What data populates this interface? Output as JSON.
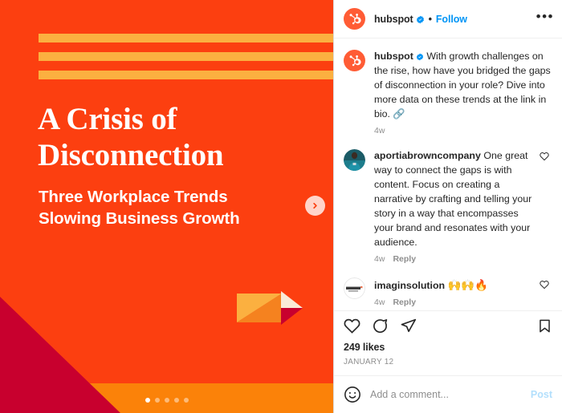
{
  "post": {
    "media": {
      "stripes_count": 3,
      "headline_line1": "A Crisis of",
      "headline_line2": "Disconnection",
      "subhead_line1": "Three Workplace Trends",
      "subhead_line2": "Slowing Business Growth",
      "colors": {
        "background": "#FC3F10",
        "stripe": "#FBB040",
        "band": "#FB8209",
        "wedge": "#C8002E",
        "arrow_light": "#FAEBD7",
        "arrow_mid": "#F5821F"
      },
      "carousel": {
        "total": 5,
        "active_index": 0
      },
      "next_icon": "chevron-right-icon"
    },
    "header": {
      "avatar_icon": "hubspot-sprocket-icon",
      "username": "hubspot",
      "verified_icon": "verified-badge-icon",
      "separator": "•",
      "follow_label": "Follow",
      "more_icon": "more-options-icon",
      "more_label": "•••"
    },
    "caption": {
      "avatar_icon": "hubspot-sprocket-icon",
      "username": "hubspot",
      "verified_icon": "verified-badge-icon",
      "text": "With growth challenges on the rise, how have you bridged the gaps of disconnection in your role? Dive into more data on these trends at the link in bio. 🔗",
      "time": "4w"
    },
    "comments": [
      {
        "avatar_icon": "user-photo-avatar",
        "username": "aportiabrowncompany",
        "text": "One great way to connect the gaps is with content. Focus on creating a narrative by crafting and telling your story in a way that encompasses your brand and resonates with your audience.",
        "time": "4w",
        "reply_label": "Reply",
        "like_icon": "heart-outline-icon"
      },
      {
        "avatar_icon": "imagine-logo-avatar",
        "username": "imaginsolution",
        "text": "🙌🙌🔥",
        "time": "4w",
        "reply_label": "Reply",
        "like_icon": "heart-outline-icon"
      }
    ],
    "actions": {
      "like_icon": "heart-outline-icon",
      "comment_icon": "comment-bubble-icon",
      "share_icon": "share-paper-plane-icon",
      "save_icon": "bookmark-outline-icon",
      "likes_text": "249 likes",
      "date_text": "JANUARY 12"
    },
    "add_comment": {
      "emoji_icon": "smiley-face-icon",
      "placeholder": "Add a comment...",
      "value": "",
      "post_label": "Post"
    }
  }
}
